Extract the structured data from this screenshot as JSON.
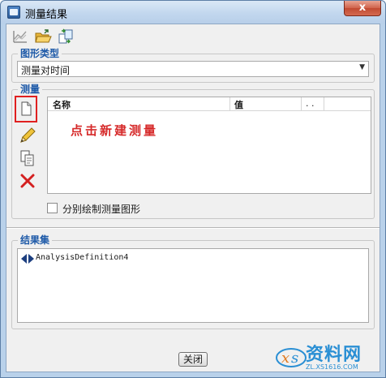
{
  "window": {
    "title": "测量结果",
    "close_glyph": "x"
  },
  "toolbar": {
    "icons": [
      "chart-icon",
      "open-folder-icon",
      "copy-transfer-icon"
    ]
  },
  "graph_type": {
    "legend": "图形类型",
    "selected": "测量对时间"
  },
  "measure": {
    "legend": "测量",
    "side_buttons": [
      "new-measure",
      "edit-measure",
      "copy-measure",
      "delete-measure"
    ],
    "columns": [
      "名称",
      "值",
      ". ."
    ],
    "annotation": "点击新建测量",
    "separate_plot_label": "分别绘制测量图形",
    "separate_plot_checked": false
  },
  "result_set": {
    "legend": "结果集",
    "items": [
      "AnalysisDefinition4"
    ]
  },
  "footer": {
    "close_label": "关闭"
  },
  "watermark": {
    "title": "资料网",
    "url": "ZL.XS1616.COM"
  },
  "colors": {
    "legend": "#1e5aa8",
    "annotation": "#d62a2a",
    "highlight": "#e02020"
  }
}
